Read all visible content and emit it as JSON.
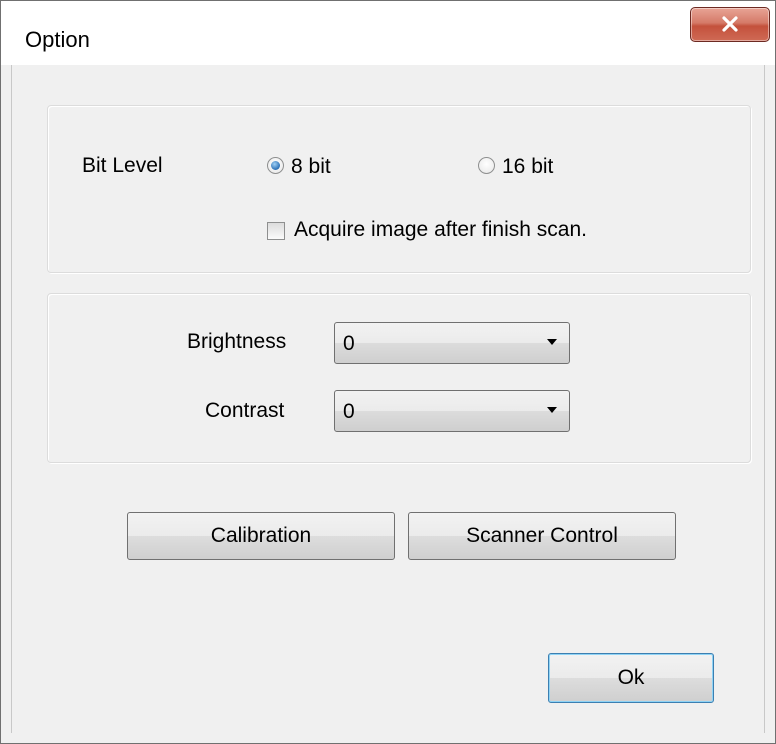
{
  "window": {
    "title": "Option"
  },
  "bit_level": {
    "label": "Bit Level",
    "options": [
      {
        "label": "8 bit",
        "selected": true
      },
      {
        "label": "16 bit",
        "selected": false
      }
    ],
    "acquire_checkbox": {
      "label": "Acquire image after finish scan.",
      "checked": false
    }
  },
  "adjustments": {
    "brightness": {
      "label": "Brightness",
      "value": "0"
    },
    "contrast": {
      "label": "Contrast",
      "value": "0"
    }
  },
  "buttons": {
    "calibration": "Calibration",
    "scanner_control": "Scanner Control",
    "ok": "Ok"
  },
  "icons": {
    "close": "close-icon",
    "dropdown": "chevron-down-icon"
  },
  "colors": {
    "close_button": "#c4513c",
    "default_button_border": "#3c7fb1",
    "radio_selected": "#2a6fb5"
  }
}
